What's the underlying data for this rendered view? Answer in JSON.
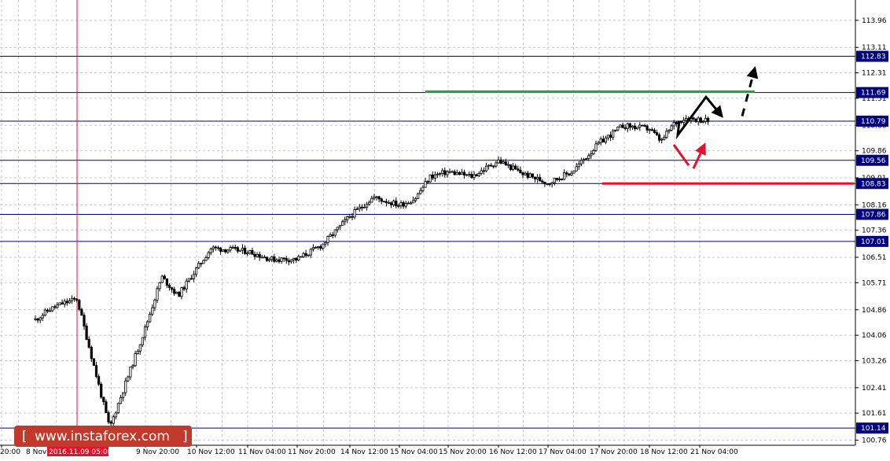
{
  "chart_data": {
    "type": "candlestick",
    "ylim": [
      100.6,
      114.6
    ],
    "y_ticks": [
      113.96,
      113.11,
      112.31,
      111.51,
      110.66,
      109.86,
      109.01,
      108.16,
      107.36,
      106.51,
      105.71,
      104.86,
      104.06,
      103.26,
      102.41,
      101.61,
      100.76
    ],
    "price_levels": [
      {
        "value": 112.83,
        "label": "112.83",
        "color": "#000080"
      },
      {
        "value": 111.69,
        "label": "111.69",
        "color": "#000080"
      },
      {
        "value": 110.79,
        "label": "110.79",
        "color": "#000080"
      },
      {
        "value": 109.56,
        "label": "109.56",
        "color": "#000080"
      },
      {
        "value": 108.83,
        "label": "108.83",
        "color": "#000080"
      },
      {
        "value": 107.86,
        "label": "107.86",
        "color": "#000080"
      },
      {
        "value": 107.01,
        "label": "107.01",
        "color": "#000080"
      },
      {
        "value": 101.14,
        "label": "101.14",
        "color": "#000080"
      }
    ],
    "x_labels": [
      "20:00",
      "8 Nov",
      "2016.11.09 05:00",
      "9 Nov 20:00",
      "10 Nov 12:00",
      "11 Nov 04:00",
      "11 Nov 20:00",
      "14 Nov 12:00",
      "15 Nov 04:00",
      "15 Nov 20:00",
      "16 Nov 12:00",
      "17 Nov 04:00",
      "17 Nov 20:00",
      "18 Nov 12:00",
      "21 Nov 04:00"
    ],
    "highlighted_time": "2016.11.09 05:00",
    "resistance_level": {
      "value": 111.72,
      "color": "#27a844"
    },
    "support_level": {
      "value": 108.83,
      "color": "#e8102a"
    },
    "price_path": [
      {
        "t": "8 Nov",
        "v": 104.55
      },
      {
        "t": "8 Nov",
        "v": 104.85
      },
      {
        "t": "8 Nov",
        "v": 105.05
      },
      {
        "t": "2016.11.09 05:00",
        "v": 105.2
      },
      {
        "t": "2016.11.09 05:00",
        "v": 101.14
      },
      {
        "t": "9 Nov 20:00",
        "v": 104.3
      },
      {
        "t": "9 Nov 20:00",
        "v": 105.9
      },
      {
        "t": "9 Nov 20:00",
        "v": 105.3
      },
      {
        "t": "10 Nov 12:00",
        "v": 106.8
      },
      {
        "t": "11 Nov 04:00",
        "v": 106.7
      },
      {
        "t": "11 Nov 04:00",
        "v": 106.45
      },
      {
        "t": "11 Nov 20:00",
        "v": 106.45
      },
      {
        "t": "11 Nov 20:00",
        "v": 106.9
      },
      {
        "t": "14 Nov 12:00",
        "v": 107.8
      },
      {
        "t": "14 Nov 12:00",
        "v": 108.4
      },
      {
        "t": "15 Nov 04:00",
        "v": 108.15
      },
      {
        "t": "15 Nov 04:00",
        "v": 108.35
      },
      {
        "t": "15 Nov 04:00",
        "v": 109.05
      },
      {
        "t": "15 Nov 20:00",
        "v": 109.2
      },
      {
        "t": "15 Nov 20:00",
        "v": 109.05
      },
      {
        "t": "16 Nov 12:00",
        "v": 109.55
      },
      {
        "t": "16 Nov 12:00",
        "v": 109.15
      },
      {
        "t": "17 Nov 04:00",
        "v": 108.85
      },
      {
        "t": "17 Nov 04:00",
        "v": 109.2
      },
      {
        "t": "17 Nov 20:00",
        "v": 110.1
      },
      {
        "t": "17 Nov 20:00",
        "v": 110.65
      },
      {
        "t": "18 Nov 12:00",
        "v": 110.55
      },
      {
        "t": "18 Nov 12:00",
        "v": 110.15
      },
      {
        "t": "18 Nov 12:00",
        "v": 110.7
      },
      {
        "t": "18 Nov 12:00",
        "v": 110.9
      },
      {
        "t": "21 Nov 04:00",
        "v": 110.8
      }
    ],
    "grid": true
  },
  "watermark": {
    "text": "www.instaforex.com",
    "bracket_left": "[",
    "bracket_right": "]",
    "bg_color": "#c0392b"
  },
  "colors": {
    "axis": "#000000",
    "grid": "#c8c8c8",
    "level_line": "#000080",
    "level_box": "#000080",
    "crosshair": "#e8102a",
    "forecast_black": "#000000",
    "forecast_red": "#e8102a"
  }
}
